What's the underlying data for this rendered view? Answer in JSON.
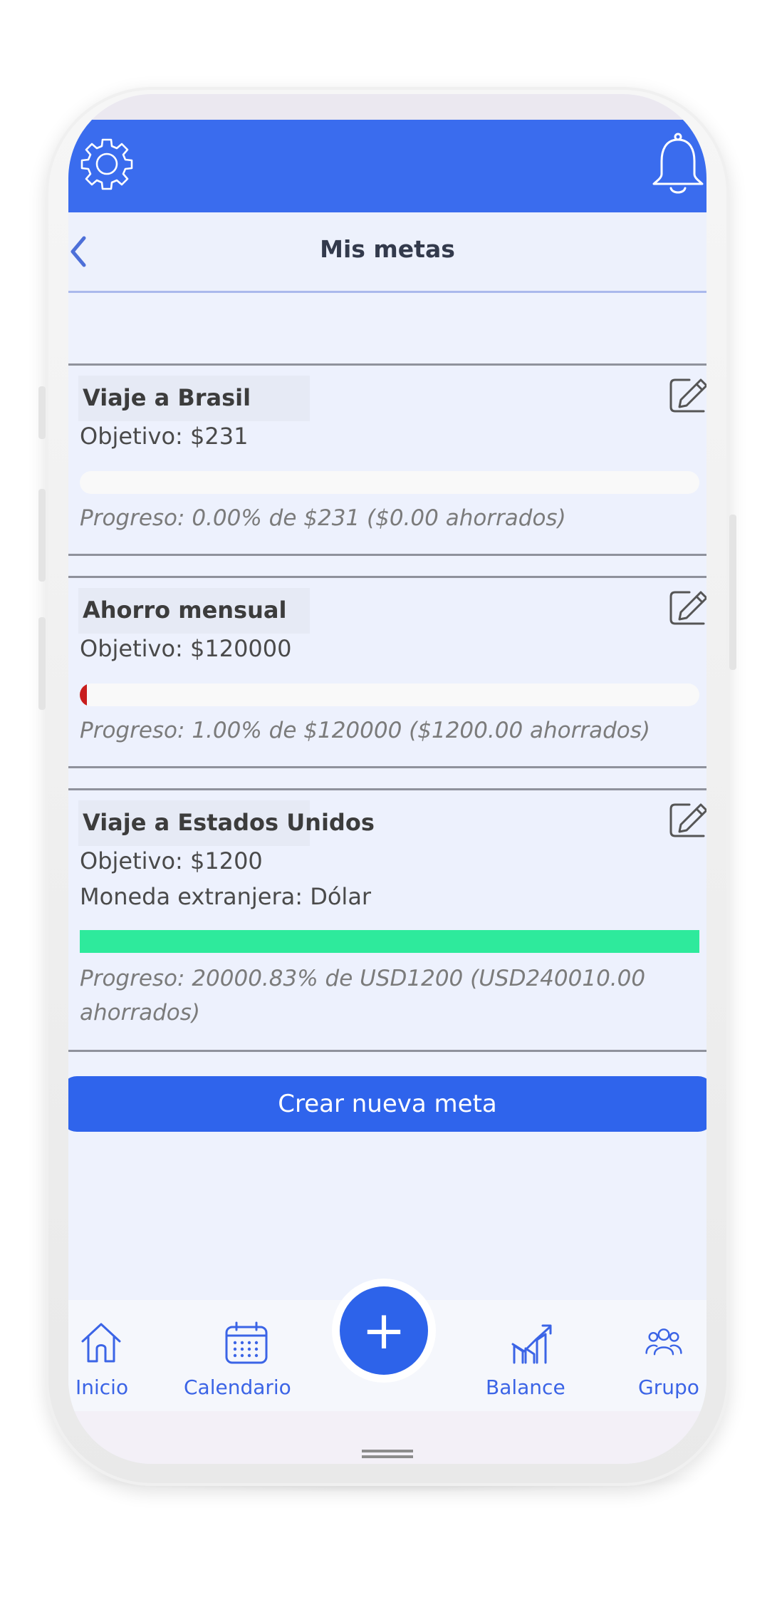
{
  "header": {
    "title": "Mis metas",
    "back_icon": "chevron-left-icon",
    "settings_icon": "gear-icon",
    "notifications_icon": "bell-icon"
  },
  "goals": [
    {
      "name": "Viaje a Brasil",
      "objective": "Objetivo: $231",
      "progress_text": "Progreso: 0.00% de $231 ($0.00 ahorrados)",
      "progress_percent": 0,
      "bar_color": "#ff3333"
    },
    {
      "name": "Ahorro mensual",
      "objective": "Objetivo: $120000",
      "progress_text": "Progreso: 1.00% de $120000 ($1200.00 ahorrados)",
      "progress_percent": 1,
      "bar_color": "#c81d1d"
    },
    {
      "name": "Viaje a Estados Unidos",
      "objective": "Objetivo: $1200",
      "currency": "Moneda extranjera: Dólar",
      "progress_text": "Progreso: 20000.83% de USD1200 (USD240010.00 ahorrados)",
      "progress_percent": 20000.83,
      "bar_color": "#2eea9c"
    }
  ],
  "actions": {
    "create_label": "Crear nueva meta"
  },
  "nav": {
    "items": [
      {
        "label": "Inicio",
        "icon": "home-icon"
      },
      {
        "label": "Calendario",
        "icon": "calendar-icon"
      },
      {
        "label": "Balance",
        "icon": "chart-icon"
      },
      {
        "label": "Grupo",
        "icon": "group-icon"
      }
    ],
    "fab_label": "+"
  },
  "colors": {
    "primary": "#3a6cee",
    "background": "#eef2fd",
    "accent_green": "#2eea9c",
    "accent_red": "#c81d1d"
  }
}
